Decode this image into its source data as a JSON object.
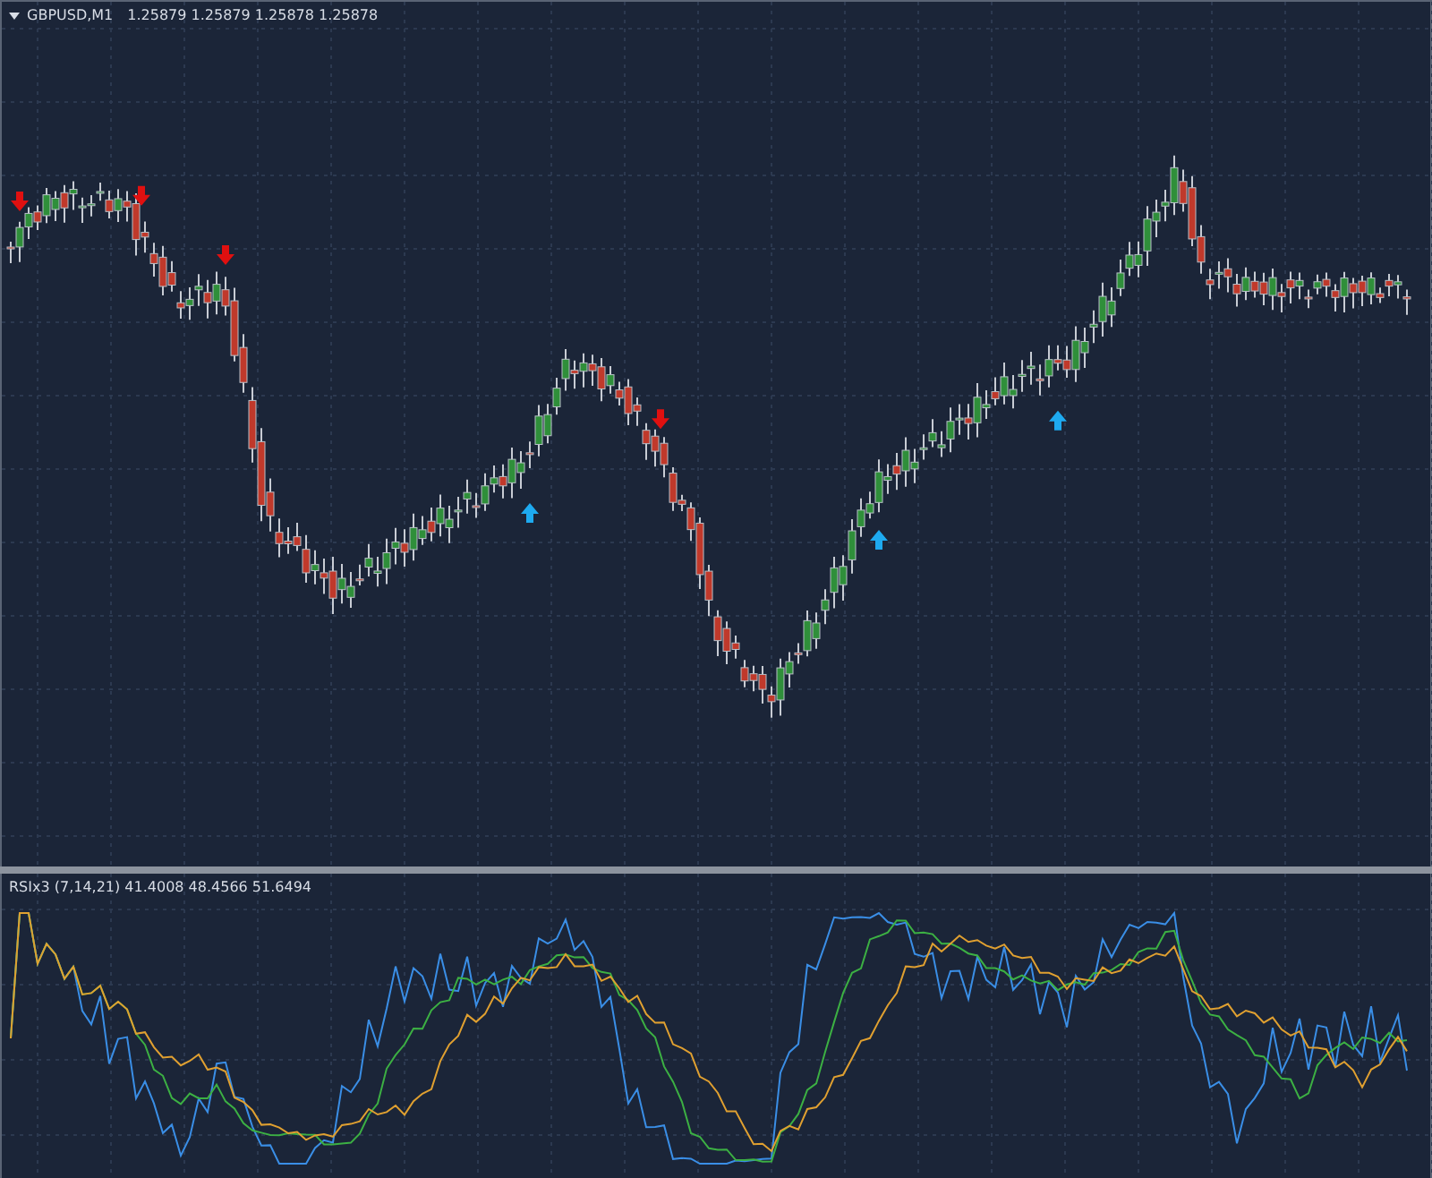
{
  "chart": {
    "symbol": "GBPUSD,M1",
    "quotes": "1.25879 1.25879 1.25878 1.25878"
  },
  "indicator": {
    "label": "RSIx3 (7,14,21) 41.4008 48.4566 51.6494"
  }
}
